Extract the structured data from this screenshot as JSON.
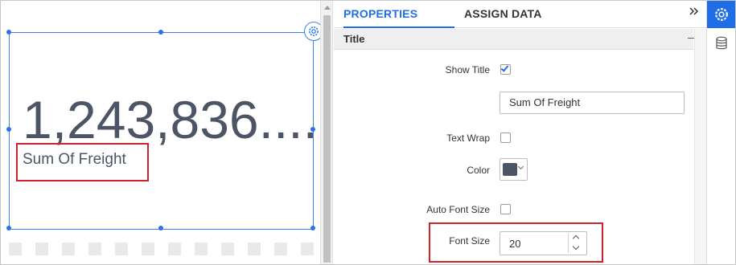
{
  "widget": {
    "value": "1,243,836....",
    "title": "Sum Of Freight"
  },
  "tabs": {
    "properties": "PROPERTIES",
    "assign_data": "ASSIGN DATA",
    "collapse_icon": "double-chevron-right"
  },
  "section": {
    "title": "Title",
    "toggle": "—"
  },
  "props": {
    "show_title_label": "Show Title",
    "show_title_checked": true,
    "title_text_value": "Sum Of Freight",
    "text_wrap_label": "Text Wrap",
    "text_wrap_checked": false,
    "color_label": "Color",
    "color_value": "#4a5566",
    "auto_font_size_label": "Auto Font Size",
    "auto_font_size_checked": false,
    "font_size_label": "Font Size",
    "font_size_value": "20"
  },
  "rail": {
    "properties_icon": "gear-icon",
    "data_icon": "database-icon"
  },
  "colors": {
    "accent": "#1f6ee8",
    "highlight": "#d0202d",
    "kpi_text": "#4b5565"
  }
}
